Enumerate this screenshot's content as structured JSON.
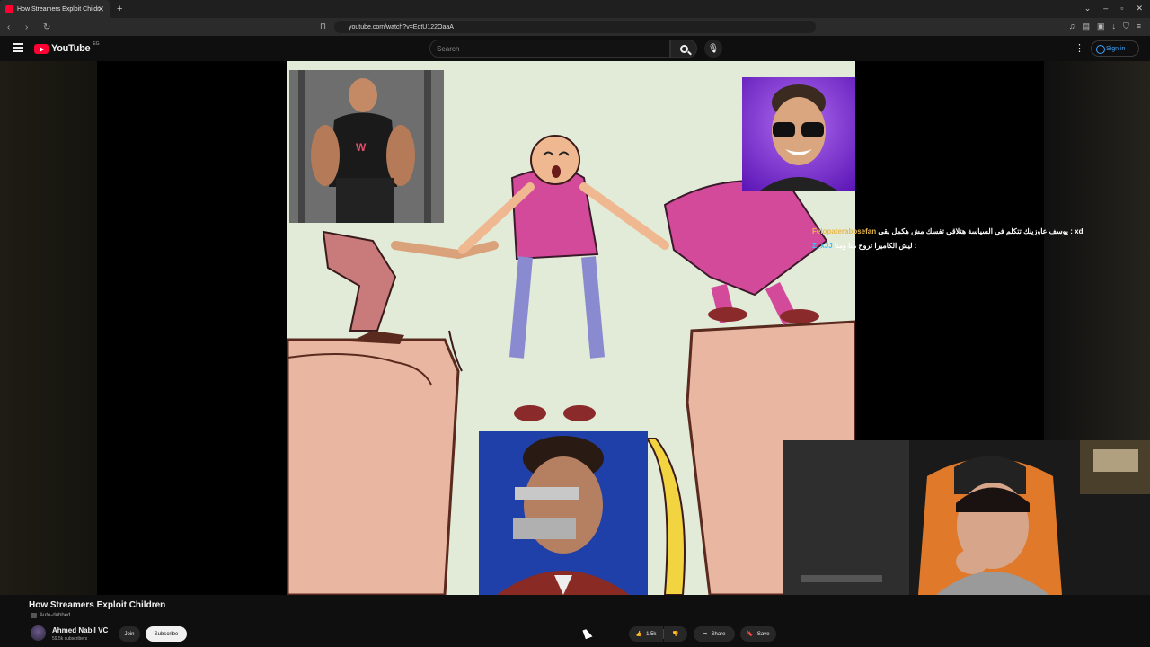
{
  "browser": {
    "tab_title": "How Streamers Exploit Childr",
    "new_tab": "+",
    "url": "youtube.com/watch?v=EdtU122OaaA"
  },
  "youtube": {
    "logo_text": "YouTube",
    "logo_country": "EG",
    "search_placeholder": "Search",
    "signin_label": "Sign in"
  },
  "video": {
    "title": "How Streamers Exploit Children",
    "auto_dubbed": "Auto-dubbed",
    "channel_name": "Ahmed Nabil VC",
    "subscribers": "59.5k subscribers",
    "join_label": "Join",
    "subscribe_label": "Subscribe",
    "likes": "1.5k",
    "share_label": "Share",
    "save_label": "Save"
  },
  "overlay_chat": [
    {
      "user": "Felopaterabosefan",
      "message": "يوسف عاوزينك تتكلم في السياسة هتلاقي تفسك مش هكمل بقى : xd"
    },
    {
      "user": "Z_xJJ",
      "message": "ليش الكاميرا تروح منا ومنا :"
    }
  ],
  "icons": {
    "tab_favicon": "youtube-favicon",
    "menu": "hamburger-icon",
    "search": "search-icon",
    "mic": "microphone-icon",
    "more": "kebab-icon",
    "account": "account-icon",
    "like": "thumb-up-icon",
    "dislike": "thumb-down-icon",
    "share": "share-icon",
    "save": "bookmark-icon"
  },
  "colors": {
    "brand_red": "#ff0033",
    "link_blue": "#3ea6ff",
    "chat_user1": "#e8b84a",
    "chat_user2": "#35c3ff"
  }
}
